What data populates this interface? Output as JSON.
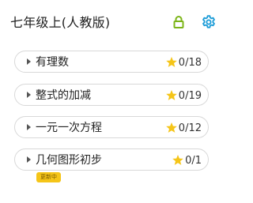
{
  "header": {
    "title": "七年级上(人教版)",
    "lock_icon": "lock-icon",
    "settings_icon": "gear-icon",
    "accent_color": "#1a9bd7",
    "lock_color": "#7cb518"
  },
  "chapters": [
    {
      "label": "有理数",
      "score": "0/18"
    },
    {
      "label": "整式的加减",
      "score": "0/19"
    },
    {
      "label": "一元一次方程",
      "score": "0/12"
    },
    {
      "label": "几何图形初步",
      "score": "0/1",
      "badge": "更新中"
    }
  ],
  "colors": {
    "star": "#f5c518",
    "badge": "#f5c518",
    "border": "#d8d8d8"
  }
}
